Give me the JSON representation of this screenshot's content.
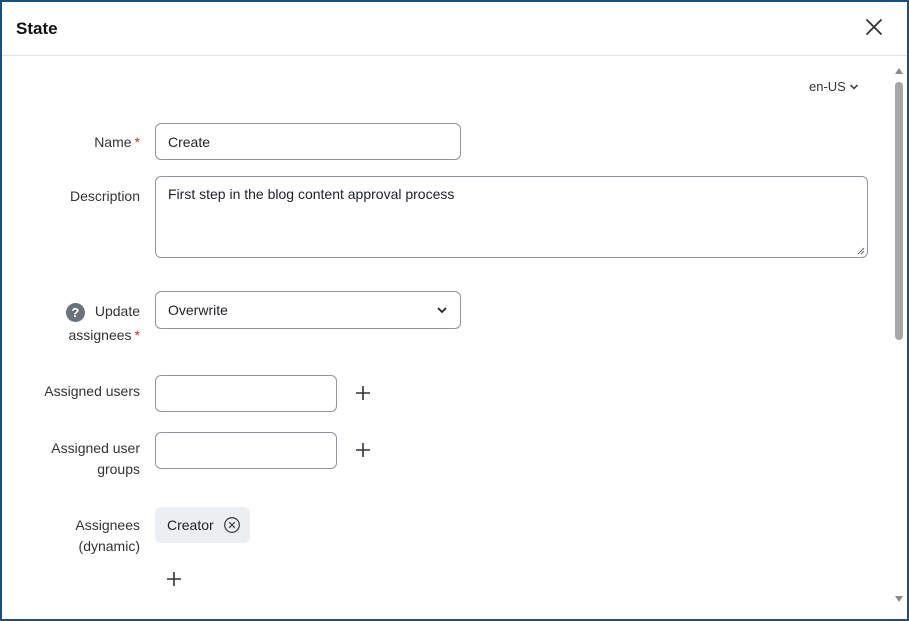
{
  "dialog": {
    "title": "State",
    "close_icon": "close-icon"
  },
  "language": {
    "value": "en-US",
    "icon": "chevron-down-icon"
  },
  "form": {
    "name": {
      "label": "Name",
      "required_mark": "*",
      "value": "Create"
    },
    "description": {
      "label": "Description",
      "value": "First step in the blog content approval process"
    },
    "update_assignees": {
      "label_line1": "Update",
      "label_line2": "assignees",
      "required_mark": "*",
      "help_icon_glyph": "?",
      "selected": "Overwrite"
    },
    "assigned_users": {
      "label": "Assigned users",
      "value": ""
    },
    "assigned_user_groups": {
      "label_line1": "Assigned user",
      "label_line2": "groups",
      "value": ""
    },
    "assignees_dynamic": {
      "label_line1": "Assignees",
      "label_line2": "(dynamic)",
      "chips": [
        {
          "label": "Creator"
        }
      ]
    }
  },
  "colors": {
    "border": "#1f4f78",
    "required": "#c0392b",
    "chip_bg": "#eceff1",
    "help_icon": "#6a737b"
  }
}
